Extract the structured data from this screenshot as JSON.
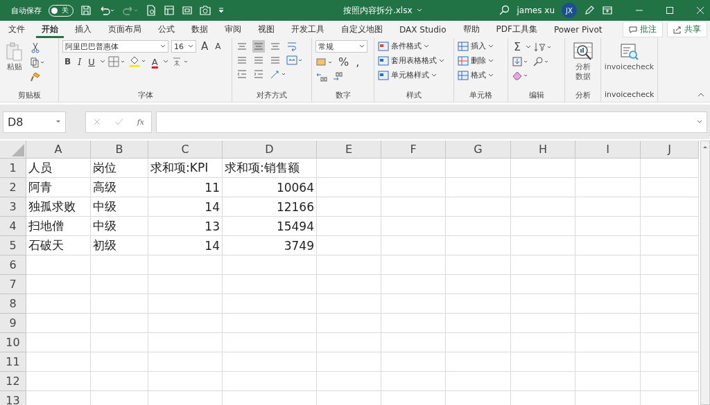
{
  "window": {
    "autosave_label": "自动保存",
    "autosave_state": "关",
    "autosave_on": false,
    "title": "按照内容拆分.xlsx",
    "user": "james xu",
    "avatar": "JX"
  },
  "tabs": [
    {
      "label": "文件",
      "selected": false
    },
    {
      "label": "开始",
      "selected": true
    },
    {
      "label": "插入",
      "selected": false
    },
    {
      "label": "页面布局",
      "selected": false
    },
    {
      "label": "公式",
      "selected": false
    },
    {
      "label": "数据",
      "selected": false
    },
    {
      "label": "审阅",
      "selected": false
    },
    {
      "label": "视图",
      "selected": false
    },
    {
      "label": "开发工具",
      "selected": false
    },
    {
      "label": "自定义地图",
      "selected": false
    },
    {
      "label": "DAX Studio",
      "selected": false
    },
    {
      "label": "帮助",
      "selected": false
    },
    {
      "label": "PDF工具集",
      "selected": false
    },
    {
      "label": "Power Pivot",
      "selected": false
    }
  ],
  "comment_button": "批注",
  "share_button": "共享",
  "clipboard": {
    "paste": "粘贴",
    "label": "剪贴板"
  },
  "font": {
    "name": "阿里巴巴普惠体",
    "size": "16",
    "grow": "A",
    "shrink": "A",
    "bold": "B",
    "italic": "I",
    "underline": "U",
    "color_letter": "A",
    "label": "字体"
  },
  "alignment": {
    "label": "对齐方式"
  },
  "number": {
    "format": "常规",
    "percent": "%",
    "comma": ",",
    "label": "数字"
  },
  "styles": {
    "items": [
      "条件格式",
      "套用表格格式",
      "单元格样式"
    ],
    "label": "样式"
  },
  "cells": {
    "items": [
      "插入",
      "删除",
      "格式"
    ],
    "label": "单元格"
  },
  "editing": {
    "sum": "Σ",
    "label": "编辑"
  },
  "analysis": {
    "button": [
      "分析",
      "数据"
    ],
    "label": "分析"
  },
  "addin": {
    "button": "invoicecheck",
    "label": "invoicecheck"
  },
  "formula_bar": {
    "name_box": "D8",
    "fx": "fx"
  },
  "sheet": {
    "columns": [
      "A",
      "B",
      "C",
      "D",
      "E",
      "F",
      "G",
      "H",
      "I",
      "J"
    ],
    "rows": [
      {
        "number": "1",
        "kind": "text",
        "cells": [
          "人员",
          "岗位",
          "求和项:KPI",
          "求和项:销售额"
        ]
      },
      {
        "number": "2",
        "kind": "values",
        "cells": [
          "阿青",
          "高级",
          "11",
          "10064"
        ]
      },
      {
        "number": "3",
        "kind": "values",
        "cells": [
          "独孤求败",
          "中级",
          "14",
          "12166"
        ]
      },
      {
        "number": "4",
        "kind": "values",
        "cells": [
          "扫地僧",
          "中级",
          "13",
          "15494"
        ]
      },
      {
        "number": "5",
        "kind": "values",
        "cells": [
          "石破天",
          "初级",
          "14",
          "3749"
        ]
      },
      {
        "number": "6"
      },
      {
        "number": "7"
      },
      {
        "number": "8"
      },
      {
        "number": "9"
      },
      {
        "number": "10"
      },
      {
        "number": "11"
      },
      {
        "number": "12"
      },
      {
        "number": "13"
      }
    ]
  }
}
